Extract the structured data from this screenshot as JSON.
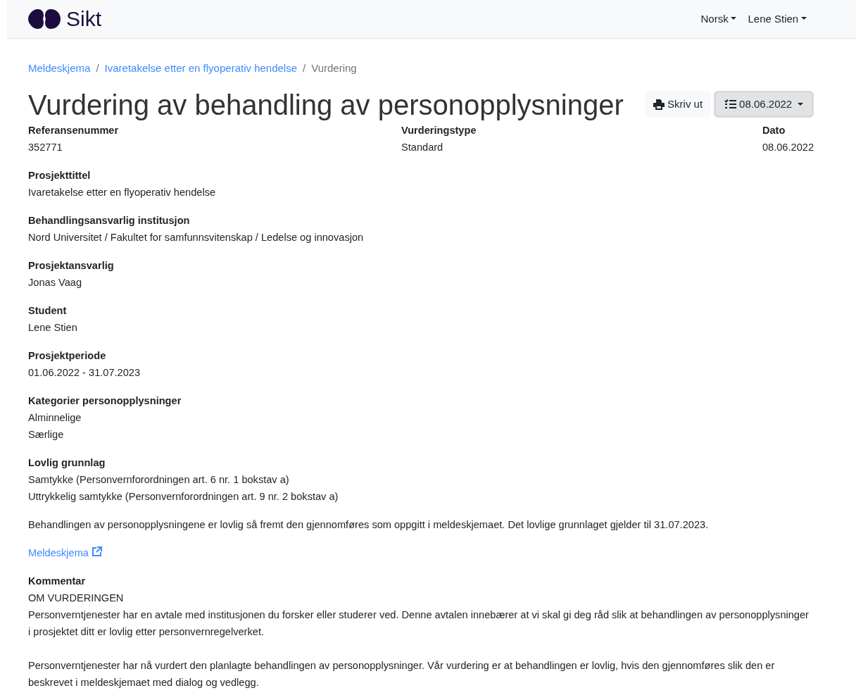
{
  "brand": {
    "name": "Sikt"
  },
  "nav": [
    {
      "label": "Norsk"
    },
    {
      "label": "Lene Stien"
    }
  ],
  "breadcrumb": [
    {
      "label": "Meldeskjema",
      "kind": "link"
    },
    {
      "separator": "/",
      "label": "Ivaretakelse etter en flyoperativ hendelse",
      "kind": "link"
    },
    {
      "separator": "/",
      "label": "Vurdering",
      "kind": "current"
    }
  ],
  "title": "Vurdering av behandling av personopplysninger",
  "toolbar": {
    "print_button": "Skriv ut",
    "version_dropdown": "08.06.2022"
  },
  "summary": [
    {
      "label": "Referansenummer",
      "value": "352771"
    },
    {
      "label": "Vurderingstype",
      "value": "Standard"
    },
    {
      "label": "Dato",
      "value": "08.06.2022"
    }
  ],
  "fields": [
    {
      "label": "Prosjekttittel",
      "values": [
        "Ivaretakelse etter en flyoperativ hendelse"
      ]
    },
    {
      "label": "Behandlingsansvarlig institusjon",
      "values": [
        "Nord Universitet / Fakultet for samfunnsvitenskap / Ledelse og innovasjon"
      ]
    },
    {
      "label": "Prosjektansvarlig",
      "values": [
        "Jonas Vaag"
      ]
    },
    {
      "label": "Student",
      "values": [
        "Lene Stien"
      ]
    },
    {
      "label": "Prosjektperiode",
      "values": [
        "01.06.2022 - 31.07.2023"
      ]
    },
    {
      "label": "Kategorier personopplysninger",
      "values": [
        "Alminnelige",
        "Særlige"
      ]
    },
    {
      "label": "Lovlig grunnlag",
      "values": [
        "Samtykke (Personvernforordningen art. 6 nr. 1 bokstav a)",
        "Uttrykkelig samtykke (Personvernforordningen art. 9 nr. 2 bokstav a)"
      ]
    }
  ],
  "statement": "Behandlingen av personopplysningene er lovlig så fremt den gjennomføres som oppgitt i meldeskjemaet. Det lovlige grunnlaget gjelder til 31.07.2023.",
  "form_link": "Meldeskjema",
  "comment": {
    "label": "Kommentar",
    "blocks": [
      [
        "OM VURDERINGEN",
        "Personverntjenester har en avtale med institusjonen du forsker eller studerer ved. Denne avtalen innebærer at vi skal gi deg råd slik at behandlingen av personopplysninger i prosjektet ditt er lovlig etter personvernregelverket."
      ],
      [
        "Personverntjenester har nå vurdert den planlagte behandlingen av personopplysninger. Vår vurdering er at behandlingen er lovlig, hvis den gjennomføres slik den er beskrevet i meldeskjemaet med dialog og vedlegg."
      ]
    ]
  }
}
